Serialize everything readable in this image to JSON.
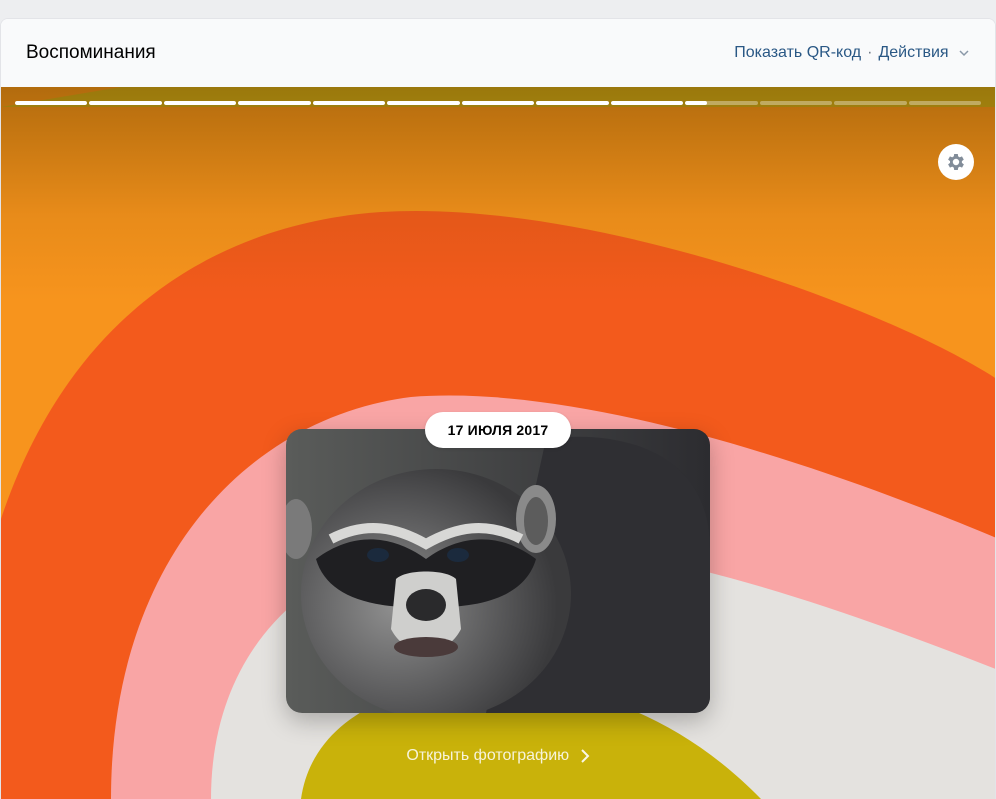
{
  "header": {
    "title": "Воспоминания",
    "qr_label": "Показать QR-код",
    "separator": "·",
    "actions_label": "Действия"
  },
  "progress": {
    "segments_total": 13,
    "segments_completed": 9,
    "current_segment_fraction": 0.3
  },
  "memory": {
    "date": "17 ИЮЛЯ 2017",
    "open_label": "Открыть фотографию"
  },
  "colors": {
    "link": "#2a5885",
    "bg_orange": "#f7941d",
    "bg_red": "#f35a1c",
    "bg_pink": "#f9a5a5",
    "bg_grey": "#e4e2df",
    "bg_olive": "#c9b20a"
  },
  "icons": {
    "settings": "gear-icon",
    "actions_chevron": "chevron-down-icon",
    "open_chevron": "chevron-right-icon"
  }
}
